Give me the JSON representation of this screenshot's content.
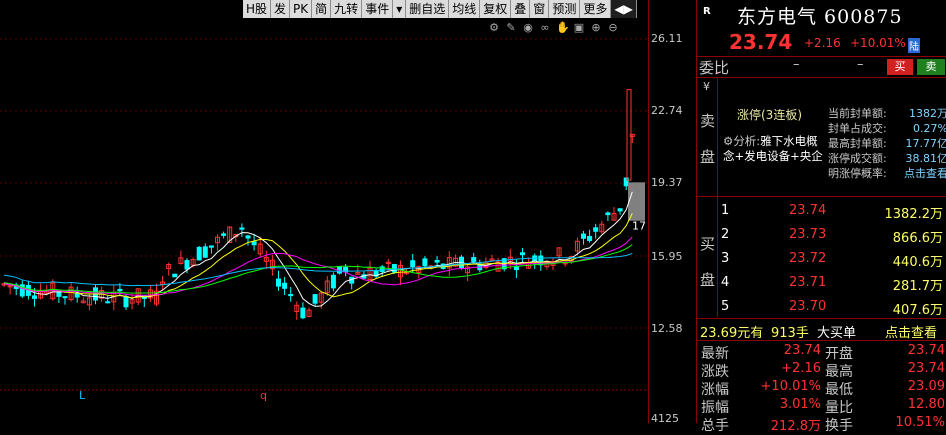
{
  "toolbar": {
    "items": [
      "H股",
      "发",
      "PK",
      "简",
      "九转",
      "事件",
      "▾",
      "删自选",
      "均线",
      "复权",
      "叠",
      "窗",
      "预测",
      "更多",
      "◀▶"
    ]
  },
  "chart": {
    "price_ticks": [
      "26.11",
      "22.74",
      "19.37",
      "15.95",
      "12.58",
      "4125"
    ],
    "current_price_tag": "17",
    "markers": [
      "L",
      "q"
    ],
    "colors": {
      "up": "#ff3232",
      "down": "#00ffff",
      "ma5": "#ffffff",
      "ma10": "#ffff00",
      "ma20": "#ff00ff",
      "ma30": "#00ff00",
      "ma60": "#00bfff"
    }
  },
  "stock": {
    "badge": "R",
    "name": "东方电气 600875",
    "price": "23.74",
    "change": "+2.16",
    "change_pct": "+10.01%",
    "market": "陆"
  },
  "weibi": {
    "label": "委比",
    "value1": "–",
    "value2": "–",
    "buy": "买",
    "sell": "卖"
  },
  "sell_side": {
    "yen": "¥",
    "label_top": "卖",
    "label_bottom": "盘",
    "limit_title": "涨停(3连板)",
    "analysis_prefix": "分析:",
    "analysis_text": "雅下水电概念+发电设备+央企",
    "stats": [
      {
        "k": "当前封单额:",
        "v": "1382万"
      },
      {
        "k": "封单占成交:",
        "v": "0.27%"
      },
      {
        "k": "最高封单额:",
        "v": "17.77亿"
      },
      {
        "k": "涨停成交额:",
        "v": "38.81亿"
      },
      {
        "k": "明涨停概率:",
        "v": "点击查看"
      }
    ]
  },
  "buy_side": {
    "label_top": "买",
    "label_bottom": "盘",
    "rows": [
      {
        "lvl": "1",
        "px": "23.74",
        "vol": "1382.2万"
      },
      {
        "lvl": "2",
        "px": "23.73",
        "vol": "866.6万"
      },
      {
        "lvl": "3",
        "px": "23.72",
        "vol": "440.6万"
      },
      {
        "lvl": "4",
        "px": "23.71",
        "vol": "281.7万"
      },
      {
        "lvl": "5",
        "px": "23.70",
        "vol": "407.6万"
      }
    ]
  },
  "trade": {
    "amount": "23.69元有",
    "hands": "913手",
    "type": "大买单",
    "action": "点击查看"
  },
  "quote": [
    {
      "k1": "最新",
      "v1": "23.74",
      "k2": "开盘",
      "v2": "23.74"
    },
    {
      "k1": "涨跌",
      "v1": "+2.16",
      "k2": "最高",
      "v2": "23.74"
    },
    {
      "k1": "涨幅",
      "v1": "+10.01%",
      "k2": "最低",
      "v2": "23.09"
    },
    {
      "k1": "振幅",
      "v1": "3.01%",
      "k2": "量比",
      "v2": "12.80"
    },
    {
      "k1": "总手",
      "v1": "212.8万",
      "k2": "换手",
      "v2": "10.51%"
    }
  ]
}
